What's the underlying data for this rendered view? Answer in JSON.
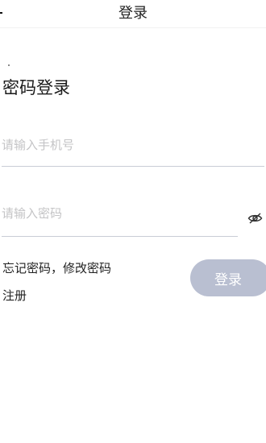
{
  "header": {
    "title": "登录"
  },
  "main": {
    "heading": "密码登录",
    "phone": {
      "placeholder": "请输入手机号",
      "value": ""
    },
    "password": {
      "placeholder": "请输入密码",
      "value": "",
      "toggle_icon": "eye-icon"
    },
    "links": {
      "forgot": "忘记密码，修改密码",
      "register": "注册"
    },
    "login_button": "登录"
  },
  "colors": {
    "button_bg": "#b9bfd1",
    "input_underline": "#c9ccd6",
    "placeholder": "#c4c4c6"
  }
}
